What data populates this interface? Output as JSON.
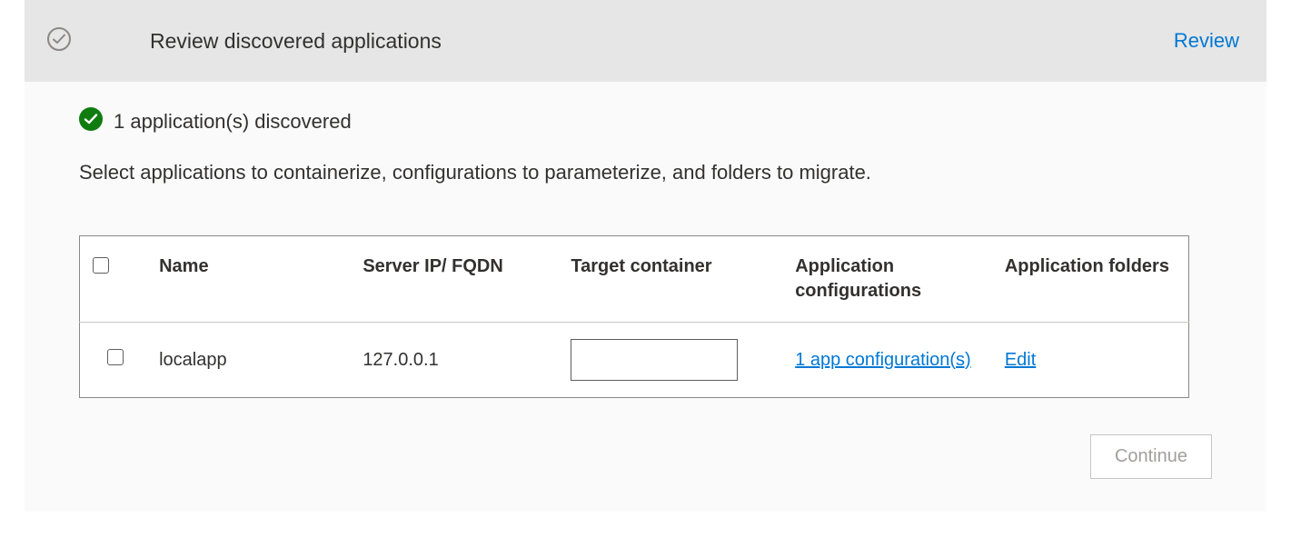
{
  "header": {
    "title": "Review discovered applications",
    "review_link": "Review"
  },
  "status": {
    "text": "1 application(s) discovered"
  },
  "description": "Select applications to containerize, configurations to parameterize, and folders to migrate.",
  "table": {
    "columns": {
      "name": "Name",
      "server": "Server IP/ FQDN",
      "target": "Target container",
      "config": "Application configurations",
      "folders": "Application folders"
    },
    "rows": [
      {
        "name": "localapp",
        "server": "127.0.0.1",
        "target": "",
        "config_link": "1 app configuration(s)",
        "folders_link": "Edit"
      }
    ]
  },
  "buttons": {
    "continue": "Continue"
  }
}
